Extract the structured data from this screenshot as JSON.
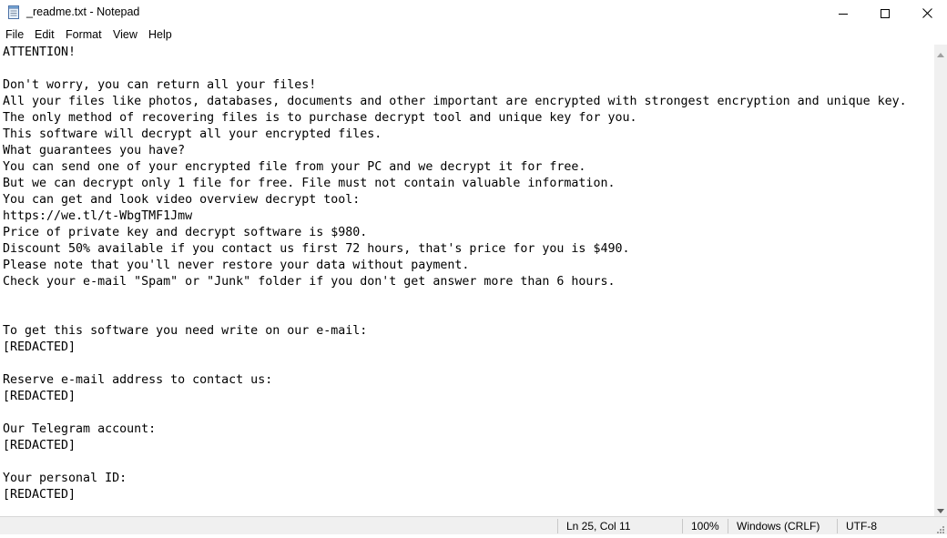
{
  "window": {
    "title": "_readme.txt - Notepad"
  },
  "menu": {
    "items": [
      "File",
      "Edit",
      "Format",
      "View",
      "Help"
    ]
  },
  "editor": {
    "content": "ATTENTION!\n\nDon't worry, you can return all your files!\nAll your files like photos, databases, documents and other important are encrypted with strongest encryption and unique key.\nThe only method of recovering files is to purchase decrypt tool and unique key for you.\nThis software will decrypt all your encrypted files.\nWhat guarantees you have?\nYou can send one of your encrypted file from your PC and we decrypt it for free.\nBut we can decrypt only 1 file for free. File must not contain valuable information.\nYou can get and look video overview decrypt tool:\nhttps://we.tl/t-WbgTMF1Jmw\nPrice of private key and decrypt software is $980.\nDiscount 50% available if you contact us first 72 hours, that's price for you is $490.\nPlease note that you'll never restore your data without payment.\nCheck your e-mail \"Spam\" or \"Junk\" folder if you don't get answer more than 6 hours.\n\n\nTo get this software you need write on our e-mail:\n[REDACTED]\n\nReserve e-mail address to contact us:\n[REDACTED]\n\nOur Telegram account:\n[REDACTED]\n\nYour personal ID:\n[REDACTED]"
  },
  "status": {
    "position": "Ln 25, Col 11",
    "zoom": "100%",
    "line_ending": "Windows (CRLF)",
    "encoding": "UTF-8"
  },
  "icons": {
    "app": "notepad-icon",
    "minimize": "minimize-icon",
    "maximize": "maximize-icon",
    "close": "close-icon",
    "scroll_up": "scroll-up-arrow-icon",
    "scroll_down": "scroll-down-arrow-icon",
    "grip": "resize-grip-icon"
  }
}
